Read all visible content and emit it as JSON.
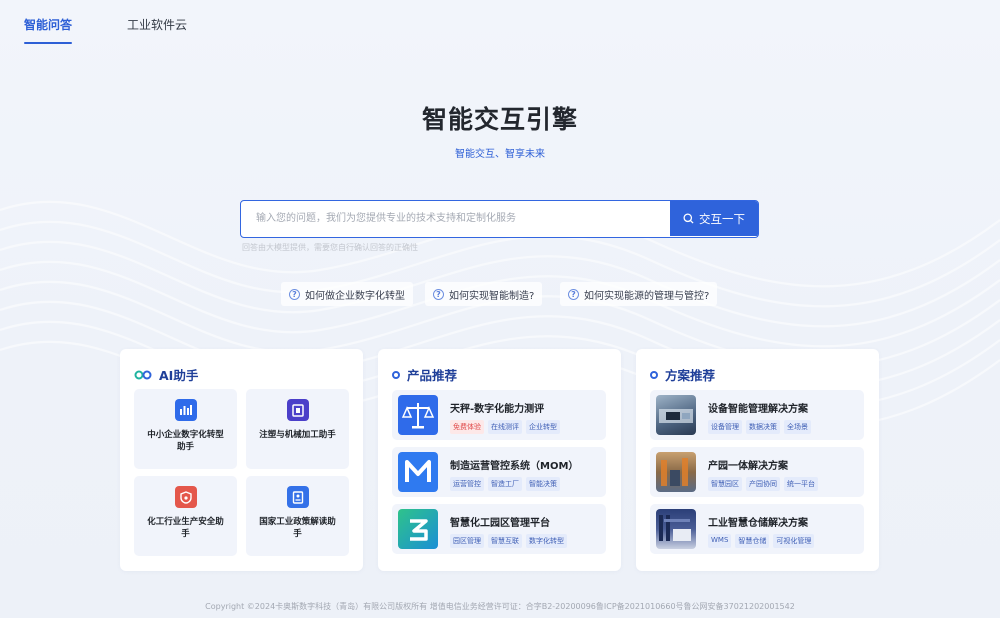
{
  "nav": {
    "tabs": [
      {
        "label": "智能问答"
      },
      {
        "label": "工业软件云"
      }
    ]
  },
  "hero": {
    "title": "智能交互引擎",
    "subtitle": "智能交互、智享未来"
  },
  "search": {
    "placeholder": "输入您的问题，我们为您提供专业的技术支持和定制化服务",
    "value": "",
    "button_label": "交互一下",
    "hint": "回答由大模型提供，需要您自行确认回答的正确性"
  },
  "quick_questions": [
    {
      "label": "如何做企业数字化转型"
    },
    {
      "label": "如何实现智能制造?"
    },
    {
      "label": "如何实现能源的管理与管控?"
    }
  ],
  "ai_assistant": {
    "title": "AI助手",
    "items": [
      {
        "label": "中小企业数字化转型助手",
        "icon": "bar-chart-icon",
        "color": "#2f6bea"
      },
      {
        "label": "注塑与机械加工助手",
        "icon": "machine-icon",
        "color": "#4b3fc9"
      },
      {
        "label": "化工行业生产安全助手",
        "icon": "safety-icon",
        "color": "#e4574b"
      },
      {
        "label": "国家工业政策解读助手",
        "icon": "policy-doc-icon",
        "color": "#3471e8"
      }
    ]
  },
  "products": {
    "title": "产品推荐",
    "items": [
      {
        "title": "天秤-数字化能力测评",
        "icon": "scale-icon",
        "tags": [
          {
            "text": "免费体验",
            "style": "red"
          },
          {
            "text": "在线测评"
          },
          {
            "text": "企业转型"
          }
        ]
      },
      {
        "title": "制造运营管控系统（MOM）",
        "icon": "mom-logo-icon",
        "tags": [
          {
            "text": "运营管控"
          },
          {
            "text": "智造工厂"
          },
          {
            "text": "智能决策"
          }
        ]
      },
      {
        "title": "智慧化工园区管理平台",
        "icon": "park-logo-icon",
        "tags": [
          {
            "text": "园区管理"
          },
          {
            "text": "智慧互联"
          },
          {
            "text": "数字化转型"
          }
        ]
      }
    ]
  },
  "solutions": {
    "title": "方案推荐",
    "items": [
      {
        "title": "设备智能管理解决方案",
        "icon": "equipment-photo",
        "tags": [
          {
            "text": "设备管理"
          },
          {
            "text": "数据决策"
          },
          {
            "text": "全场景"
          }
        ]
      },
      {
        "title": "产园一体解决方案",
        "icon": "factory-photo",
        "tags": [
          {
            "text": "智慧园区"
          },
          {
            "text": "产园协同"
          },
          {
            "text": "统一平台"
          }
        ]
      },
      {
        "title": "工业智慧仓储解决方案",
        "icon": "warehouse-photo",
        "tags": [
          {
            "text": "WMS"
          },
          {
            "text": "智慧仓储"
          },
          {
            "text": "可视化管理"
          }
        ]
      }
    ]
  },
  "footer": {
    "text": "Copyright ©2024卡奥斯数字科技（青岛）有限公司版权所有 增值电信业务经营许可证：合字B2-20200096鲁ICP备2021010660号鲁公网安备37021202001542"
  },
  "colors": {
    "accent": "#2f63db",
    "heading": "#1f3f99",
    "tag_bg": "#e4ebfb",
    "tag_red": "#e04848"
  }
}
